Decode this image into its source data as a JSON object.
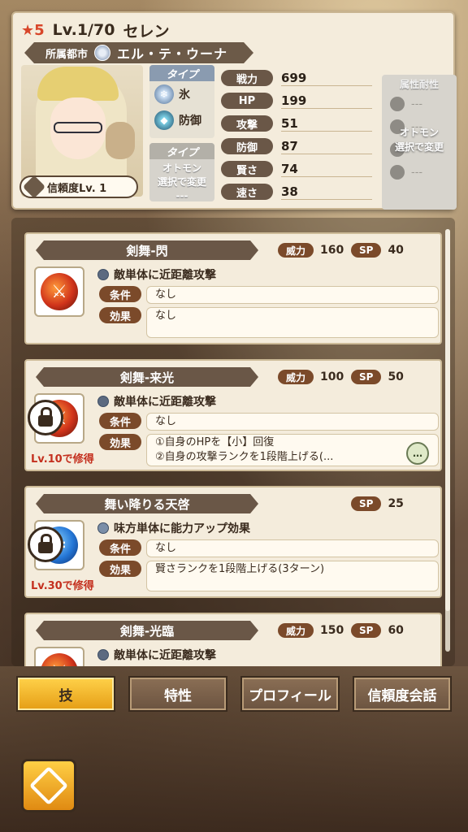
{
  "header": {
    "rarity": "★5",
    "level": "Lv.1/70",
    "character_name": "セレン",
    "city_label": "所属都市",
    "city_name": "エル・テ・ウーナ",
    "trust_label": "信頼度Lv. 1",
    "type_header": "タイプ",
    "types": [
      "氷",
      "防御"
    ],
    "otomon_header": "タイプ",
    "otomon_text": "オトモン\n選択で変更",
    "otomon_dash": "---",
    "stats": [
      {
        "label": "戦力",
        "value": "699"
      },
      {
        "label": "HP",
        "value": "199"
      },
      {
        "label": "攻撃",
        "value": "51"
      },
      {
        "label": "防御",
        "value": "87"
      },
      {
        "label": "賢さ",
        "value": "74"
      },
      {
        "label": "速さ",
        "value": "38"
      }
    ],
    "attr_header": "属性耐性",
    "attr_note": "オトモン\n選択で変更",
    "attr_values": [
      "---",
      "---",
      "---",
      "---"
    ]
  },
  "skills": [
    {
      "name": "剣舞-閃",
      "power_label": "威力",
      "power": "160",
      "sp_label": "SP",
      "sp": "40",
      "target": "敵単体に近距離攻撃",
      "cond_label": "条件",
      "condition": "なし",
      "effect_label": "効果",
      "effect": "なし",
      "locked": false,
      "learn": ""
    },
    {
      "name": "剣舞-来光",
      "power_label": "威力",
      "power": "100",
      "sp_label": "SP",
      "sp": "50",
      "target": "敵単体に近距離攻撃",
      "cond_label": "条件",
      "condition": "なし",
      "effect_label": "効果",
      "effect": "①自身のHPを【小】回復\n②自身の攻撃ランクを1段階上げる(...",
      "locked": true,
      "learn": "Lv.10で修得"
    },
    {
      "name": "舞い降りる天啓",
      "power_label": "",
      "power": "",
      "sp_label": "SP",
      "sp": "25",
      "target": "味方単体に能力アップ効果",
      "cond_label": "条件",
      "condition": "なし",
      "effect_label": "効果",
      "effect": "賢さランクを1段階上げる(3ターン)",
      "locked": true,
      "learn": "Lv.30で修得"
    },
    {
      "name": "剣舞-光臨",
      "power_label": "威力",
      "power": "150",
      "sp_label": "SP",
      "sp": "60",
      "target": "敵単体に近距離攻撃"
    }
  ],
  "more_label": "…",
  "tabs": [
    "技",
    "特性",
    "プロフィール",
    "信頼度会話"
  ],
  "colors": {
    "active_tab": "#f0b52a",
    "panel": "#f4ecdc",
    "label_bg": "#6a5747",
    "lock_text": "#c4301f"
  }
}
